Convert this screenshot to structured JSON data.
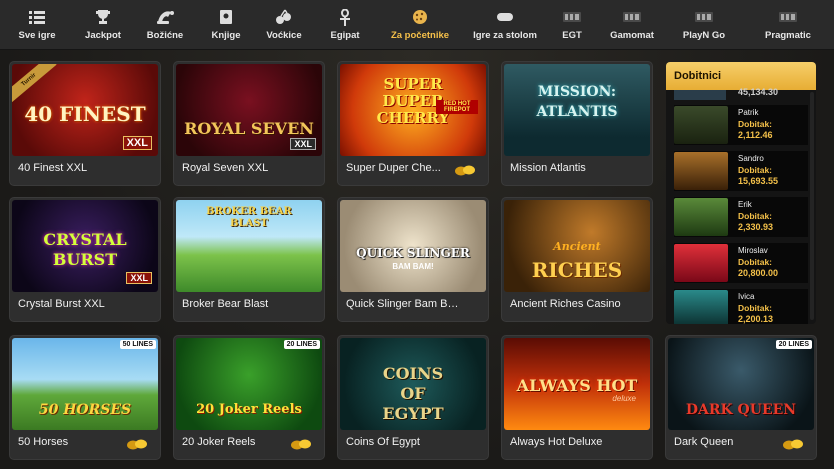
{
  "nav": {
    "items": [
      {
        "label": "Sve igre",
        "icon": "list-icon"
      },
      {
        "label": "Jackpot",
        "icon": "trophy-icon"
      },
      {
        "label": "Božićne",
        "icon": "santa-hat-icon"
      },
      {
        "label": "Knjige",
        "icon": "book-icon"
      },
      {
        "label": "Voćkice",
        "icon": "cherries-icon"
      },
      {
        "label": "Egipat",
        "icon": "ankh-icon"
      },
      {
        "label": "Za početnike",
        "icon": "cookie-icon",
        "active": true
      },
      {
        "label": "Igre za stolom",
        "icon": "chip-icon"
      },
      {
        "label": "EGT",
        "icon": "egt-logo-icon"
      },
      {
        "label": "Gamomat",
        "icon": "gamomat-logo-icon"
      },
      {
        "label": "PlayN Go",
        "icon": "playngo-logo-icon"
      },
      {
        "label": "Pragmatic",
        "icon": "pragmatic-logo-icon"
      }
    ],
    "active_color": "#f5c04a"
  },
  "games": [
    {
      "title": "40 Finest XXL",
      "art_text": "40 FINEST",
      "art_sub": "XXL",
      "ribbon": "Turnir"
    },
    {
      "title": "Royal Seven XXL",
      "art_text": "ROYAL SEVEN",
      "art_sub": "XXL"
    },
    {
      "title": "Super Duper Che...",
      "art_text": "SUPER DUPER CHERRY",
      "art_sub": "RED HOT FIREPOT",
      "coins": true
    },
    {
      "title": "Mission Atlantis",
      "art_text": "MISSION: ATLANTIS"
    },
    {
      "title": "Crystal Burst XXL",
      "art_text": "CRYSTAL BURST",
      "art_sub": "XXL"
    },
    {
      "title": "Broker Bear Blast",
      "art_text": "BROKER BEAR BLAST"
    },
    {
      "title": "Quick Slinger Bam Bam!",
      "art_text": "QUICK SLINGER",
      "art_sub": "BAM BAM!"
    },
    {
      "title": "Ancient Riches Casino",
      "art_text": "RICHES",
      "art_sub": "Ancient"
    },
    {
      "title": "50 Horses",
      "art_text": "50 HORSES",
      "art_sub": "50 LINES",
      "coins": true
    },
    {
      "title": "20 Joker Reels",
      "art_text": "20 Joker Reels",
      "art_sub": "20 LINES",
      "coins": true
    },
    {
      "title": "Coins Of Egypt",
      "art_text": "COINS OF EGYPT"
    },
    {
      "title": "Always Hot Deluxe",
      "art_text": "ALWAYS HOT",
      "art_sub": "deluxe"
    },
    {
      "title": "Dark Queen",
      "art_text": "DARK QUEEN",
      "art_sub": "20 LINES",
      "coins": true
    }
  ],
  "winners": {
    "title": "Dobitnici",
    "peek_amount": "45,134.30",
    "label": "Dobitak:",
    "rows": [
      {
        "name": "Patrik",
        "amount": "2,112.46"
      },
      {
        "name": "Sandro",
        "amount": "15,693.55"
      },
      {
        "name": "Erik",
        "amount": "2,330.93"
      },
      {
        "name": "Miroslav",
        "amount": "20,800.00"
      },
      {
        "name": "Ivica",
        "amount": "2,200.13"
      }
    ],
    "accent": "#f4c14a"
  }
}
